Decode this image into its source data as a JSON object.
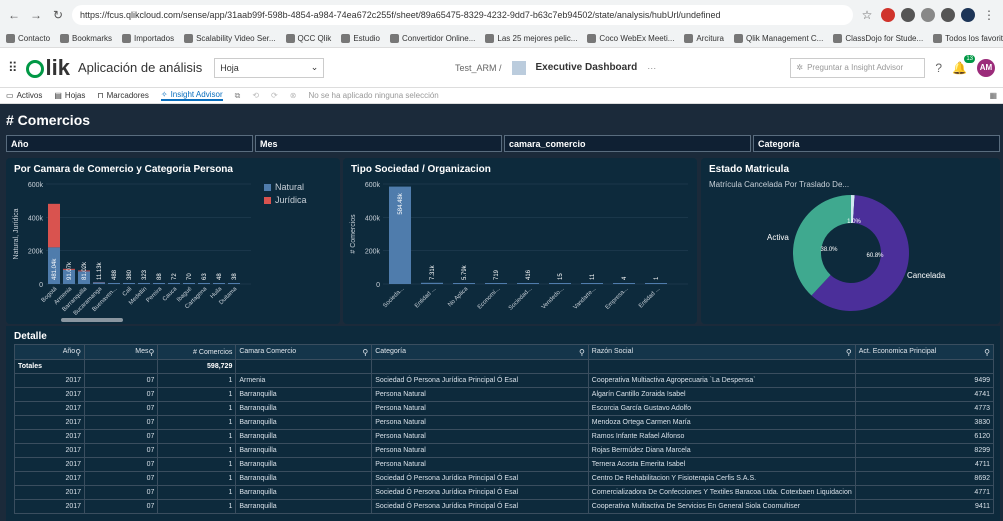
{
  "browser": {
    "url": "https://fcus.qlikcloud.com/sense/app/31aab99f-598b-4854-a984-74ea672c255f/sheet/89a65475-8329-4232-9dd7-b63c7eb94502/state/analysis/hubUrl/undefined",
    "bookmarks": [
      "Contacto",
      "Bookmarks",
      "Importados",
      "Scalability Video Ser...",
      "QCC Qlik",
      "Estudio",
      "Convertidor Online...",
      "Las 25 mejores pelic...",
      "Coco WebEx Meeti...",
      "Arcitura",
      "Qlik Management C...",
      "ClassDojo for Stude...",
      "Todos los favoritos"
    ]
  },
  "header": {
    "app_title": "Aplicación de análisis",
    "sheet_select": "Hoja",
    "breadcrumb": "Test_ARM /",
    "dashboard_title": "Executive Dashboard",
    "ask_placeholder": "Preguntar a Insight Advisor",
    "avatar": "AM",
    "badge_count": "13"
  },
  "toolbar": {
    "activos": "Activos",
    "hojas": "Hojas",
    "marcadores": "Marcadores",
    "insight_advisor": "Insight Advisor",
    "no_selection": "No se ha aplicado ninguna selección"
  },
  "sheet": {
    "title": "# Comercios",
    "filters": [
      "Año",
      "Mes",
      "camara_comercio",
      "Categoría"
    ]
  },
  "colors": {
    "natural": "#4f7cac",
    "juridica": "#d9534f",
    "activa": "#3fa98f",
    "cancelada": "#4b2f9a",
    "traslado": "#d0e8f0"
  },
  "chart_data": [
    {
      "type": "bar",
      "title": "Por Camara de Comercio y Categoria Persona",
      "ylabel": "Natural, Jurídica",
      "categories": [
        "Bogotá",
        "Armenia",
        "Barranquilla",
        "Bucaramanga",
        "Buenaven...",
        "Cali",
        "Medellín",
        "Pereira",
        "Cauca",
        "Ibagué",
        "Cartagena",
        "Huila",
        "Duitama"
      ],
      "value_labels": [
        "481.04k",
        "91.07k",
        "81.02k",
        "11.13k",
        "488",
        "380",
        "323",
        "88",
        "72",
        "70",
        "63",
        "48",
        "38"
      ],
      "series": [
        {
          "name": "Natural",
          "values": [
            220000,
            85000,
            76000,
            10000,
            400,
            300,
            250,
            70,
            60,
            55,
            50,
            40,
            30
          ]
        },
        {
          "name": "Jurídica",
          "values": [
            261040,
            6070,
            5020,
            1130,
            88,
            80,
            73,
            18,
            12,
            15,
            13,
            8,
            8
          ]
        }
      ],
      "yticks": [
        "0",
        "200k",
        "400k",
        "600k"
      ],
      "ylim": [
        0,
        600000
      ],
      "legend": "top-right"
    },
    {
      "type": "bar",
      "title": "Tipo Sociedad / Organizacion",
      "ylabel": "# Comercios",
      "categories": [
        "Socieda...",
        "Entidad ...",
        "No Aplica",
        "Economí...",
        "Sociedad...",
        "Vendedo...",
        "Vandarte...",
        "Empresa...",
        "Entidad ..."
      ],
      "value_labels": [
        "584.48k",
        "7.31k",
        "5.79k",
        "719",
        "416",
        "15",
        "11",
        "4",
        "1"
      ],
      "values": [
        584480,
        7310,
        5790,
        719,
        416,
        15,
        11,
        4,
        1
      ],
      "yticks": [
        "0",
        "200k",
        "400k",
        "600k"
      ],
      "ylim": [
        0,
        600000
      ]
    },
    {
      "type": "pie",
      "title": "Estado Matricula",
      "subtitle": "Matrícula Cancelada Por Traslado De...",
      "slices": [
        {
          "label": "Cancelada",
          "value": 60.8
        },
        {
          "label": "Activa",
          "value": 38.0
        },
        {
          "label": "Matrícula Cancelada Por Traslado De...",
          "value": 1.0
        }
      ],
      "slice_labels": [
        "60.8%",
        "38.0%",
        "1.0%"
      ]
    }
  ],
  "table": {
    "title": "Detalle",
    "columns": [
      "Año",
      "Mes",
      "# Comercios",
      "Camara Comercio",
      "Categoría",
      "Razón Social",
      "Act. Economica Principal"
    ],
    "totals_label": "Totales",
    "totals_value": "598,729",
    "rows": [
      [
        "2017",
        "07",
        "1",
        "Armenia",
        "Sociedad Ó Persona Jurídica Principal Ó Esal",
        "Cooperativa Multiactiva Agropecuaria `La Despensa`",
        "9499"
      ],
      [
        "2017",
        "07",
        "1",
        "Barranquilla",
        "Persona Natural",
        "Algarín Cantillo Zoraida Isabel",
        "4741"
      ],
      [
        "2017",
        "07",
        "1",
        "Barranquilla",
        "Persona Natural",
        "Escorcia García Gustavo Adolfo",
        "4773"
      ],
      [
        "2017",
        "07",
        "1",
        "Barranquilla",
        "Persona Natural",
        "Mendoza Ortega Carmen María",
        "3830"
      ],
      [
        "2017",
        "07",
        "1",
        "Barranquilla",
        "Persona Natural",
        "Ramos Infante Rafael Alfonso",
        "6120"
      ],
      [
        "2017",
        "07",
        "1",
        "Barranquilla",
        "Persona Natural",
        "Rojas Bermúdez Diana Marcela",
        "8299"
      ],
      [
        "2017",
        "07",
        "1",
        "Barranquilla",
        "Persona Natural",
        "Ternera Acosta Emerita Isabel",
        "4711"
      ],
      [
        "2017",
        "07",
        "1",
        "Barranquilla",
        "Sociedad Ó Persona Jurídica Principal Ó Esal",
        "Centro De Rehabilitacion Y Fisioterapia Cerfis S.A.S.",
        "8692"
      ],
      [
        "2017",
        "07",
        "1",
        "Barranquilla",
        "Sociedad Ó Persona Jurídica Principal Ó Esal",
        "Comercializadora De Confecciones Y Textiles Baracoa Ltda. Cotexbaen Liquidacion",
        "4771"
      ],
      [
        "2017",
        "07",
        "1",
        "Barranquilla",
        "Sociedad Ó Persona Jurídica Principal Ó Esal",
        "Cooperativa Multiactiva De Servicios En General Siola Coomultiser",
        "9411"
      ]
    ]
  }
}
